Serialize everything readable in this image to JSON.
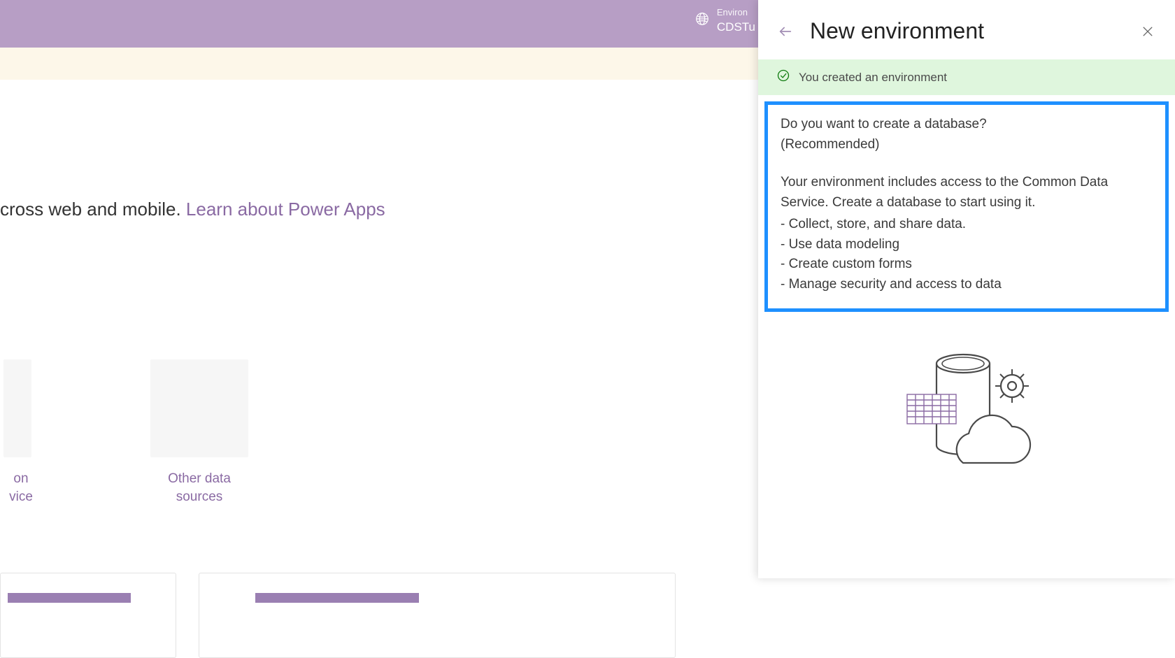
{
  "header": {
    "env_label": "Environ",
    "env_value": "CDSTu"
  },
  "main": {
    "tagline_prefix": "cross web and mobile. ",
    "tagline_link": "Learn about Power Apps",
    "tiles": {
      "a_line1": "on",
      "a_line2": "vice",
      "b_line1": "Other data",
      "b_line2": "sources"
    }
  },
  "panel": {
    "title": "New environment",
    "success_msg": "You created an environment",
    "q_line1": "Do you want to create a database?",
    "q_line2": "(Recommended)",
    "desc": "Your environment includes access to the Common Data Service. Create a database to start using it.",
    "bullets": [
      "- Collect, store, and share data.",
      "- Use data modeling",
      "- Create custom forms",
      "- Manage security and access to data"
    ]
  }
}
